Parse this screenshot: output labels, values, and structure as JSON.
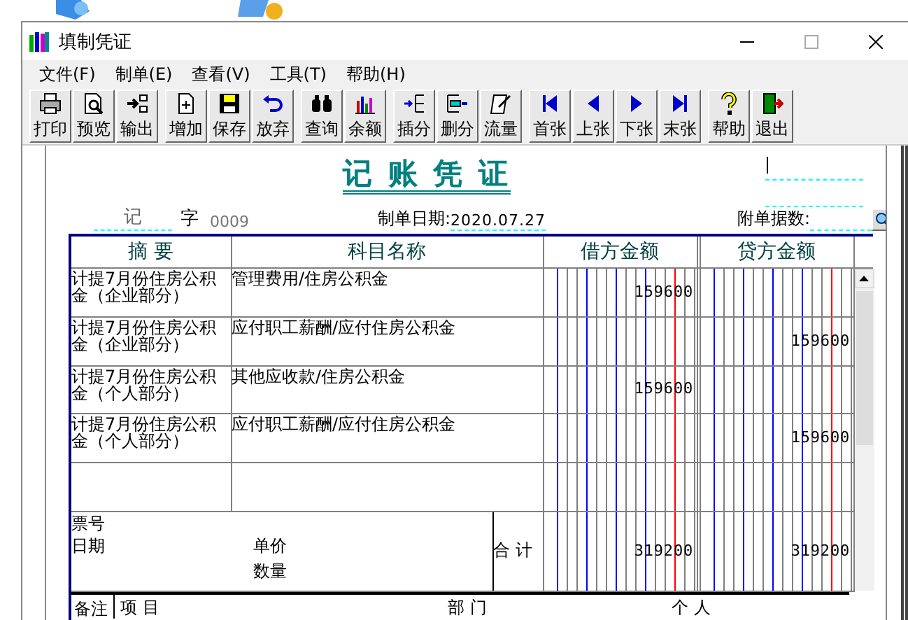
{
  "window": {
    "title": "填制凭证"
  },
  "menu": [
    "文件(F)",
    "制单(E)",
    "查看(V)",
    "工具(T)",
    "帮助(H)"
  ],
  "toolbar": [
    [
      "打印",
      "预览",
      "输出"
    ],
    [
      "增加",
      "保存",
      "放弃"
    ],
    [
      "查询",
      "余额"
    ],
    [
      "插分",
      "删分",
      "流量"
    ],
    [
      "首张",
      "上张",
      "下张",
      "末张"
    ],
    [
      "帮助",
      "退出"
    ]
  ],
  "voucher": {
    "title": "记 账 凭 证",
    "type": "记",
    "type_suffix": "字",
    "number": "0009",
    "date_label": "制单日期:",
    "date": "2020.07.27",
    "attachments_label": "附单据数:"
  },
  "table": {
    "columns": [
      "摘 要",
      "科目名称",
      "借方金额",
      "贷方金额"
    ],
    "rows": [
      {
        "summary": "计提7月份住房公积金（企业部分）",
        "account": "管理费用/住房公积金",
        "debit": "159600",
        "credit": ""
      },
      {
        "summary": "计提7月份住房公积金（企业部分）",
        "account": "应付职工薪酬/应付住房公积金",
        "debit": "",
        "credit": "159600"
      },
      {
        "summary": "计提7月份住房公积金（个人部分）",
        "account": "其他应收款/住房公积金",
        "debit": "159600",
        "credit": ""
      },
      {
        "summary": "计提7月份住房公积金（个人部分）",
        "account": "应付职工薪酬/应付住房公积金",
        "debit": "",
        "credit": "159600"
      },
      {
        "summary": "",
        "account": "",
        "debit": "",
        "credit": ""
      }
    ],
    "footer": {
      "ticket_label": "票号",
      "date_label": "日期",
      "price_label": "单价",
      "quantity_label": "数量",
      "total_label": "合 计",
      "debit_total": "319200",
      "credit_total": "319200"
    },
    "remarks": {
      "label": "备注",
      "item_label": "项 目",
      "department_label": "部 门",
      "person_label": "个 人"
    }
  }
}
